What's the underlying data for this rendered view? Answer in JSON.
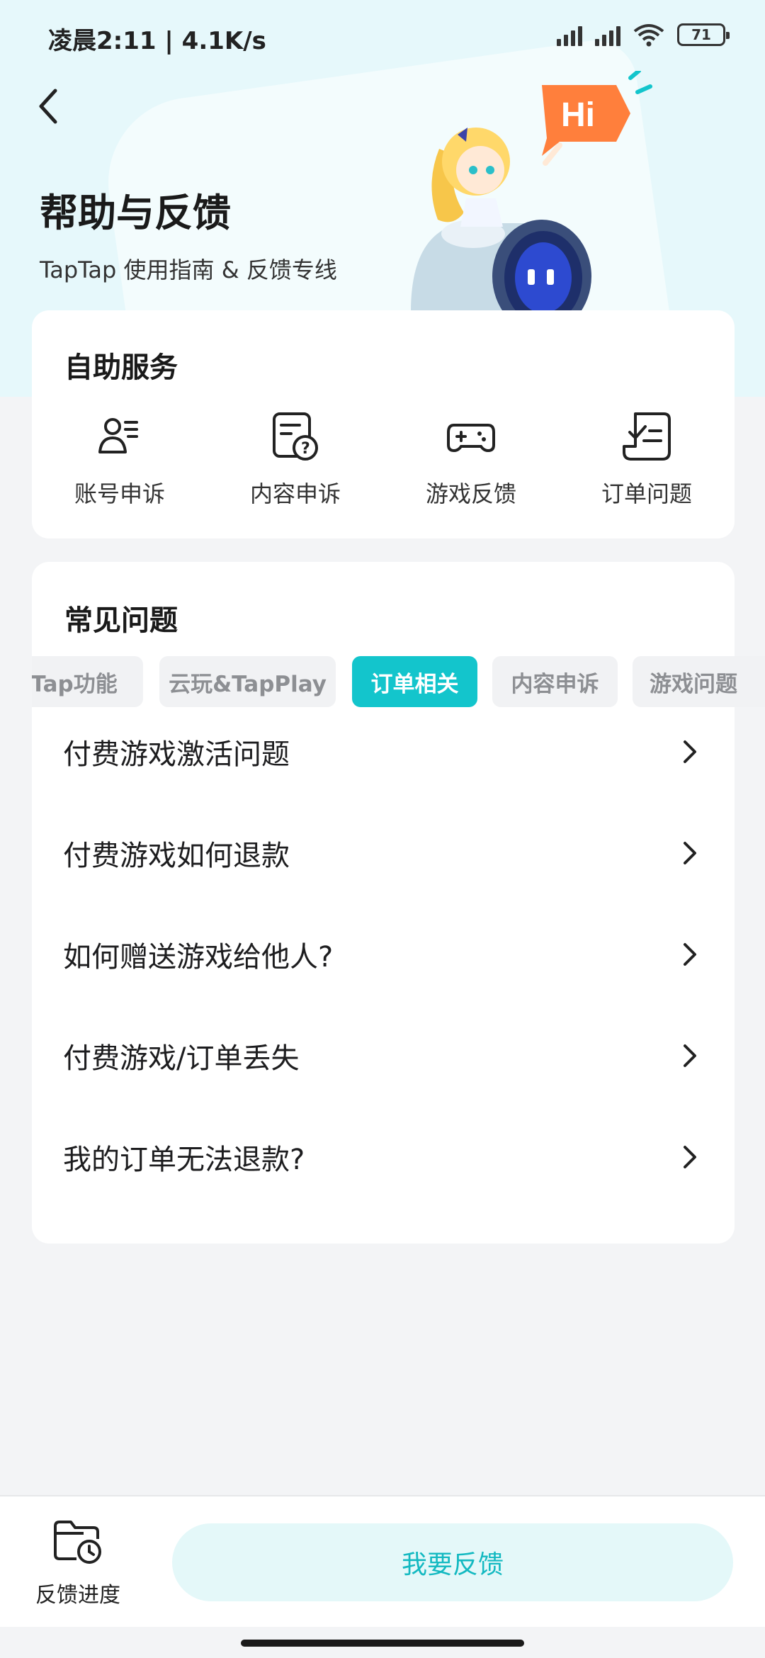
{
  "status_bar": {
    "time": "凌晨2:11",
    "speed": "4.1K/s",
    "battery": "71"
  },
  "header": {
    "title": "帮助与反馈",
    "subtitle": "TapTap 使用指南 & 反馈专线",
    "mascot_bubble": "Hi"
  },
  "self_service": {
    "title": "自助服务",
    "items": [
      {
        "label": "账号申诉",
        "icon": "user-list-icon"
      },
      {
        "label": "内容申诉",
        "icon": "document-question-icon"
      },
      {
        "label": "游戏反馈",
        "icon": "gamepad-icon"
      },
      {
        "label": "订单问题",
        "icon": "order-check-icon"
      }
    ]
  },
  "faq": {
    "title": "常见问题",
    "tabs": [
      "pTap功能",
      "云玩&TapPlay",
      "订单相关",
      "内容申诉",
      "游戏问题"
    ],
    "active_tab": "订单相关",
    "items": [
      "付费游戏激活问题",
      "付费游戏如何退款",
      "如何赠送游戏给他人?",
      "付费游戏/订单丢失",
      "我的订单无法退款?"
    ]
  },
  "bottom": {
    "progress_label": "反馈进度",
    "feedback_button": "我要反馈"
  },
  "colors": {
    "accent": "#13c5cc",
    "hero_bg": "#e6f8fb",
    "button_bg": "#e4f8f9"
  }
}
